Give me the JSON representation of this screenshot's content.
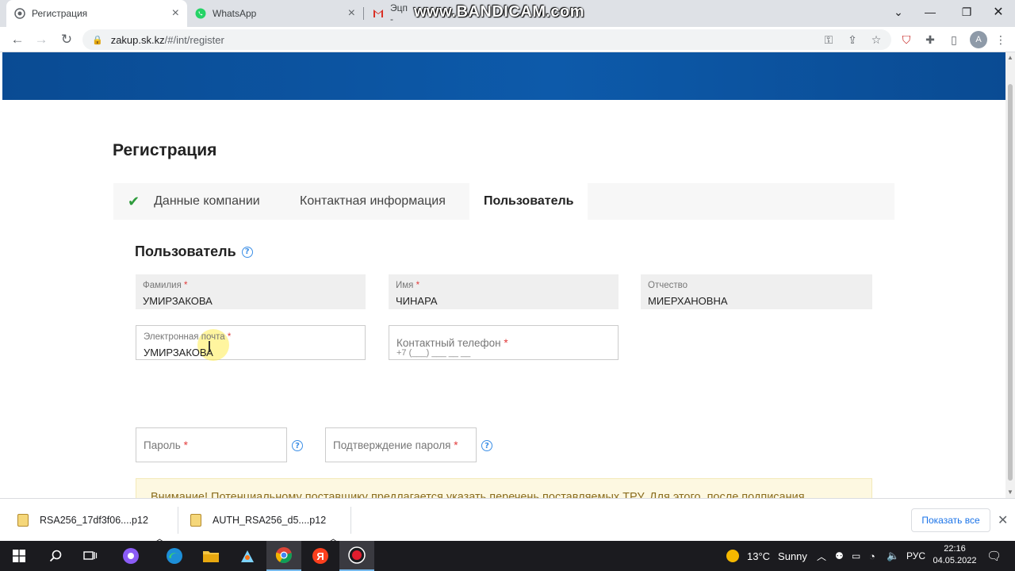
{
  "browser": {
    "tabs": [
      {
        "title": "Регистрация",
        "active": true
      },
      {
        "title": "WhatsApp",
        "active": false
      },
      {
        "title": "Эцп -",
        "active": false
      }
    ],
    "overlay_watermark": "www.BANDICAM.com",
    "url_host": "zakup.sk.kz",
    "url_path": "/#/int/register",
    "profile_initial": "A"
  },
  "page": {
    "title": "Регистрация",
    "steps": [
      {
        "label": "Данные компании",
        "done": true
      },
      {
        "label": "Контактная информация",
        "done": false
      },
      {
        "label": "Пользователь",
        "active": true
      }
    ],
    "section_title": "Пользователь",
    "required_mark": "*",
    "fields": {
      "lastname": {
        "label": "Фамилия",
        "value": "УМИРЗАКОВА"
      },
      "firstname": {
        "label": "Имя",
        "value": "ЧИНАРА"
      },
      "middlename": {
        "label": "Отчество",
        "value": "МИЕРХАНОВНА"
      },
      "email": {
        "label": "Электронная почта",
        "value": "УМИРЗАКОВА"
      },
      "phone": {
        "label": "Контактный телефон",
        "mask": "+7 (___) ___ __ __"
      },
      "password": {
        "label": "Пароль"
      },
      "password_confirm": {
        "label": "Подтверждение пароля"
      }
    },
    "help_glyph": "?",
    "alert": "Внимание! Потенциальному поставщику предлагается указать перечень поставляемых ТРУ. Для этого, после подписания соглашения, необходимо пройти в раздел \"Управление ценами - Прайс-лист\"."
  },
  "downloads": {
    "items": [
      "RSA256_17df3f06....p12",
      "AUTH_RSA256_d5....p12"
    ],
    "show_all": "Показать все"
  },
  "taskbar": {
    "weather_temp": "13°C",
    "weather_text": "Sunny",
    "lang": "РУС",
    "time": "22:16",
    "date": "04.05.2022"
  },
  "colors": {
    "banner": "#0d5aaa",
    "check": "#2e9b3c",
    "required": "#e23b3b",
    "help": "#3a8ee6",
    "alert_bg": "#fdf8e1",
    "alert_text": "#8a6d1f",
    "link": "#1a73e8"
  }
}
